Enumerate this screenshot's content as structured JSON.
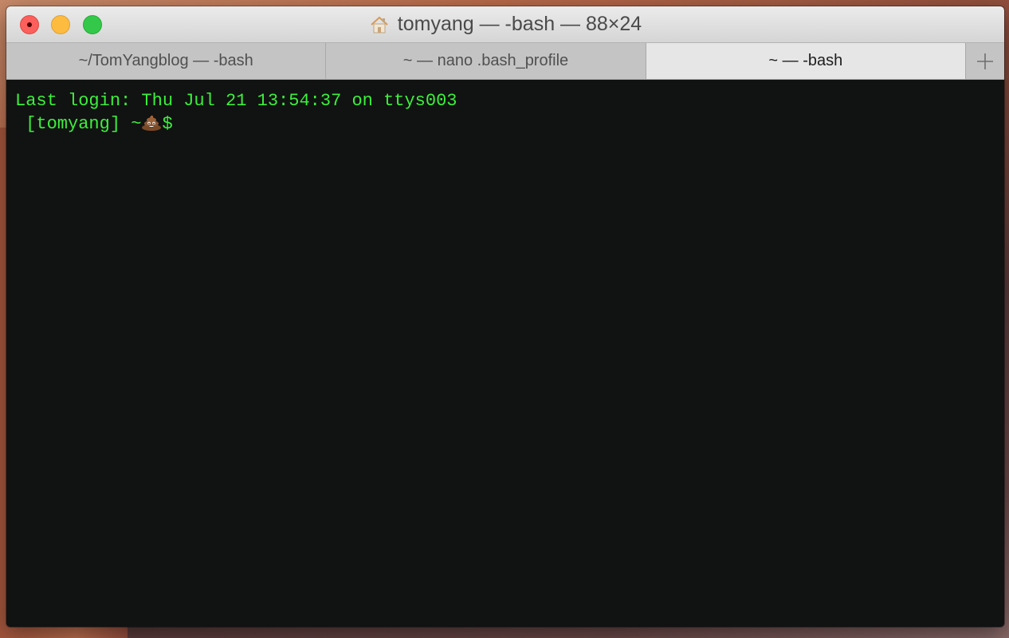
{
  "window": {
    "title": "tomyang — -bash — 88×24",
    "title_icon": "house-icon"
  },
  "tabs": [
    {
      "label": "~/TomYangblog — -bash",
      "active": false
    },
    {
      "label": "~ — nano .bash_profile",
      "active": false
    },
    {
      "label": "~ — -bash",
      "active": true
    }
  ],
  "add_tab_icon": "plus-icon",
  "terminal": {
    "last_login": "Last login: Thu Jul 21 13:54:37 on ttys003",
    "prompt_user": " [tomyang] ~",
    "prompt_icon": "poop-icon",
    "prompt_suffix": "$",
    "text_color": "#3cf03c",
    "background": "#111212"
  }
}
